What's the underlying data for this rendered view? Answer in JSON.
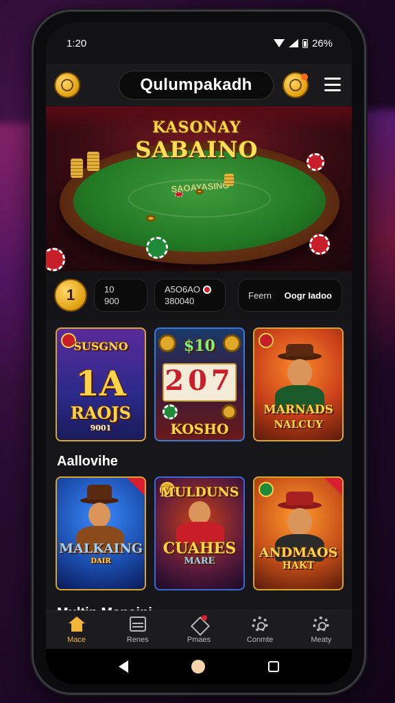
{
  "status_bar": {
    "time": "1:20",
    "battery": "26%"
  },
  "header": {
    "title": "Qulumpakadh"
  },
  "hero": {
    "title_line1": "KASONAY",
    "title_line2": "SABAINO",
    "felt_text": "SAOAYASINO"
  },
  "info_row": {
    "rank": "1",
    "pill_a": {
      "line1": "10",
      "line2": "900"
    },
    "pill_b": {
      "line1": "A5O6AO",
      "line2": "380040"
    },
    "pill_c": {
      "label": "Feern",
      "value": "Oogr Iadoo"
    }
  },
  "games_row1": [
    {
      "title_top": "SUSGNO",
      "title_big": "1A",
      "title_sub": "RAOJS",
      "footer": "9001"
    },
    {
      "title_top": "$10",
      "title_big": "207",
      "title_sub": "KOSHO"
    },
    {
      "title_line1": "MARNADS",
      "title_line2": "NALCUY"
    }
  ],
  "section1": "Aallovihe",
  "games_row2": [
    {
      "title_line1": "MALKAING",
      "footer": "DAIR"
    },
    {
      "title_line1": "MULDUNS",
      "title_line2": "CUAHES",
      "title_line3": "MARE"
    },
    {
      "title_line1": "ANDMAOS",
      "title_line2": "HAKT"
    }
  ],
  "section2": "Multip Manaini",
  "bottom_nav": [
    {
      "label": "Mace",
      "icon": "home-icon",
      "active": true
    },
    {
      "label": "Renes",
      "icon": "games-icon"
    },
    {
      "label": "Pmaes",
      "icon": "promo-icon"
    },
    {
      "label": "Conmte",
      "icon": "settings-icon"
    },
    {
      "label": "Meaty",
      "icon": "gear-icon"
    }
  ],
  "colors": {
    "accent": "#f3b53a",
    "gold": "#ffd34a",
    "felt": "#237a24",
    "background": "#121114"
  }
}
